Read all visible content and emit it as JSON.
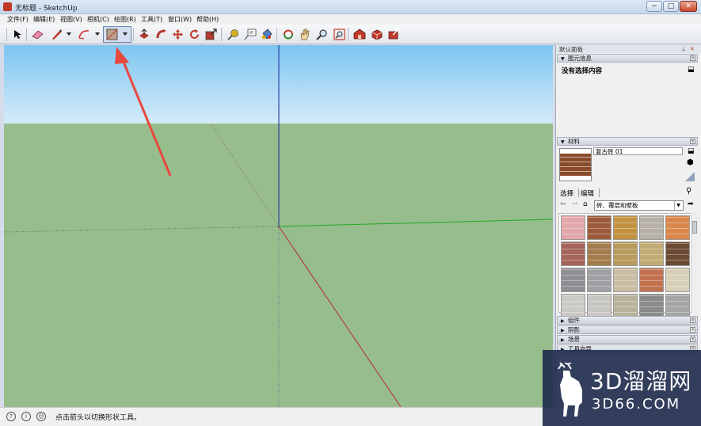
{
  "window": {
    "title": "无标题 - SketchUp",
    "minimize": "−",
    "maximize": "□",
    "close": "✕"
  },
  "menu": [
    "文件(F)",
    "编辑(E)",
    "视图(V)",
    "相机(C)",
    "绘图(R)",
    "工具(T)",
    "窗口(W)",
    "帮助(H)"
  ],
  "toolbar": {
    "icons": [
      "select-arrow-icon",
      "eraser-icon",
      "pencil-line-icon",
      "arc-icon",
      "shape-rectangle-icon",
      "push-pull-icon",
      "follow-me-icon",
      "move-icon",
      "rotate-icon",
      "scale-icon",
      "tape-measure-icon",
      "text-label-icon",
      "paint-bucket-icon",
      "orbit-icon",
      "pan-icon",
      "zoom-icon",
      "zoom-extents-icon",
      "warehouse-icon",
      "components-icon",
      "share-icon"
    ],
    "active_tool": "shape-rectangle-icon"
  },
  "colors": {
    "sky_top": "#7ec5f1",
    "ground": "#98bd8c",
    "axis_blue": "#1a2ea0",
    "axis_red": "#b12d2d",
    "axis_green": "#21a821",
    "arrow_annotation": "#e8493f"
  },
  "panel": {
    "tray_title": "默认面板",
    "entity_info": {
      "header": "图元信息",
      "content": "没有选择内容"
    },
    "materials": {
      "header": "材料",
      "current_name": "复古砖 01",
      "tabs": [
        "选择",
        "编辑"
      ],
      "collection": "砖、覆层和壁板",
      "swatches": [
        [
          "#e3a7a9",
          "#9b5a3a",
          "#c29240",
          "#b6b0a8",
          "#d9874a"
        ],
        [
          "#a4645a",
          "#a37c4c",
          "#b79a5c",
          "#c1ab74",
          "#6a4a33"
        ],
        [
          "#8f8f93",
          "#9fa0a3",
          "#c9bea4",
          "#c1714e",
          "#d8cfb8"
        ],
        [
          "#cbc9c5",
          "#c8c6c3",
          "#b7b39a",
          "#8b8b8b",
          "#a6a6a6"
        ]
      ]
    },
    "collapsed": [
      {
        "label": "组件"
      },
      {
        "label": "阴影"
      },
      {
        "label": "场景"
      },
      {
        "label": "工具向导"
      }
    ]
  },
  "status": {
    "text": "点击箭头以切换形状工具。",
    "icons": [
      "question-icon",
      "info-icon",
      "user-icon"
    ]
  },
  "watermark": {
    "line1": "3D溜溜网",
    "line2": "3D66.COM"
  }
}
